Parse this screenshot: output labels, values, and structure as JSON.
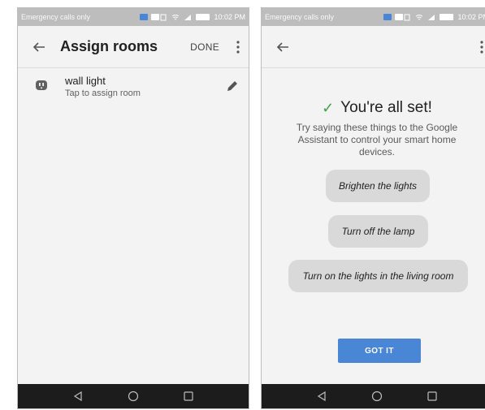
{
  "status_bar": {
    "left_text": "Emergency calls only",
    "time": "10:02 PM",
    "colors": {
      "blue": "#4a86d6",
      "white": "#ffffff"
    }
  },
  "assign_screen": {
    "title": "Assign rooms",
    "done_label": "DONE",
    "device": {
      "name": "wall light",
      "subtitle": "Tap to assign room",
      "icon": "plug-icon"
    },
    "icons": [
      "back-arrow-icon",
      "more-vert-icon",
      "plug-icon",
      "edit-pencil-icon"
    ]
  },
  "setup_screen": {
    "title": "You're all set!",
    "description": "Try saying these things to the Google Assistant to control your smart home devices.",
    "suggestions": [
      "Brighten the lights",
      "Turn off the lamp",
      "Turn on the lights in the living room"
    ],
    "button_label": "GOT IT",
    "accent_color": "#4a86d6",
    "check_color": "#43a047"
  },
  "nav_bar": {
    "buttons": [
      "back-triangle-icon",
      "home-circle-icon",
      "recents-square-icon"
    ]
  }
}
